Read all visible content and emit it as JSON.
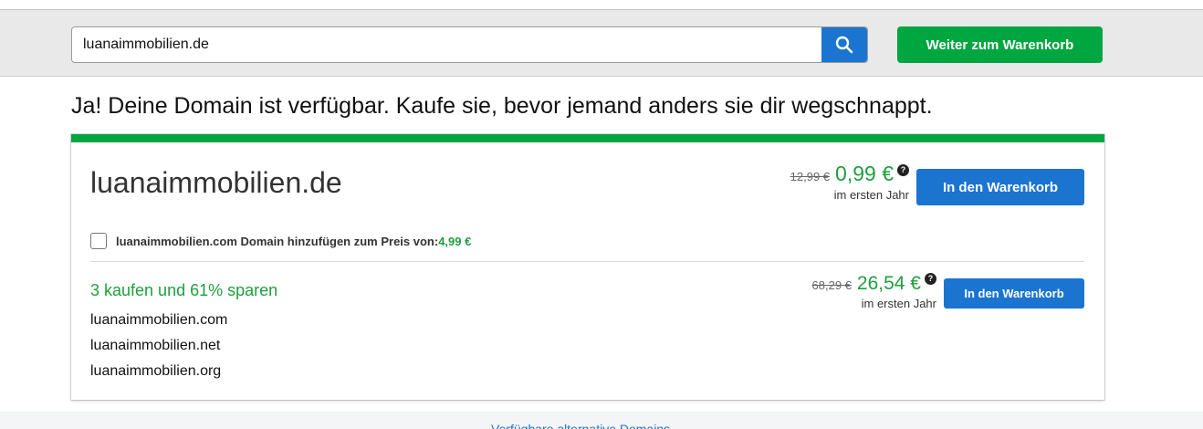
{
  "search": {
    "value": "luanaimmobilien.de",
    "button_icon": "search-icon"
  },
  "header": {
    "cart_button_label": "Weiter zum Warenkorb"
  },
  "headline": "Ja! Deine Domain ist verfügbar. Kaufe sie, bevor jemand anders sie dir wegschnappt.",
  "main_offer": {
    "domain": "luanaimmobilien.de",
    "old_price": "12,99 €",
    "new_price": "0,99 €",
    "price_note": "im ersten Jahr",
    "button_label": "In den Warenkorb",
    "addon_text": "luanaimmobilien.com Domain hinzufügen zum Preis von:",
    "addon_price": "4,99 €"
  },
  "bundle": {
    "title": "3 kaufen und 61% sparen",
    "domains": [
      "luanaimmobilien.com",
      "luanaimmobilien.net",
      "luanaimmobilien.org"
    ],
    "old_price": "68,29 €",
    "new_price": "26,54 €",
    "price_note": "im ersten Jahr",
    "button_label": "In den Warenkorb"
  },
  "footer": {
    "alternatives_link": "Verfügbare alternative Domains"
  },
  "colors": {
    "accent_green": "#00a63f",
    "price_green": "#1f9e3e",
    "button_blue": "#1b75d0"
  }
}
